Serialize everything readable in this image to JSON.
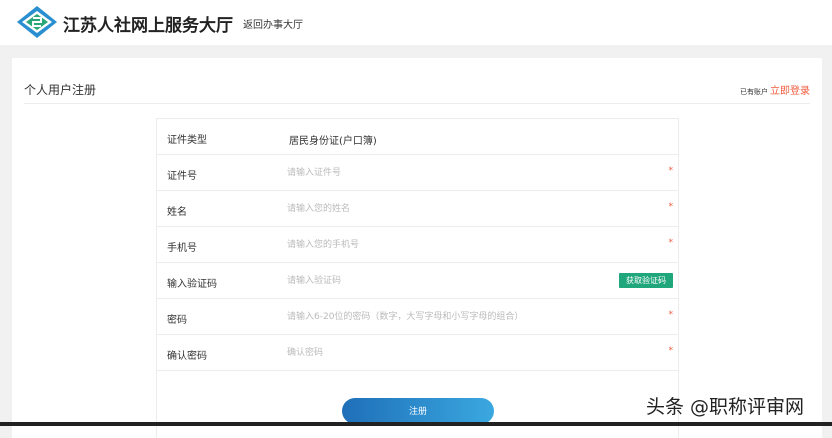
{
  "header": {
    "title": "江苏人社网上服务大厅",
    "back_link": "返回办事大厅"
  },
  "page": {
    "title": "个人用户注册",
    "have_account": "已有账户",
    "login_link": "立即登录"
  },
  "form": {
    "rows": [
      {
        "label": "证件类型",
        "value": "居民身份证(户口簿)"
      },
      {
        "label": "证件号",
        "placeholder": "请输入证件号",
        "required": "*"
      },
      {
        "label": "姓名",
        "placeholder": "请输入您的姓名",
        "required": "*"
      },
      {
        "label": "手机号",
        "placeholder": "请输入您的手机号",
        "required": "*"
      },
      {
        "label": "输入验证码",
        "placeholder": "请输入验证码",
        "button": "获取验证码"
      },
      {
        "label": "密码",
        "placeholder": "请输入6-20位的密码（数字，大写字母和小写字母的组合）",
        "required": "*"
      },
      {
        "label": "确认密码",
        "placeholder": "确认密码",
        "required": "*"
      }
    ],
    "submit": "注册"
  },
  "watermark": "头条 @职称评审网",
  "colors": {
    "accent": "#f05a3c",
    "green": "#1fa67a",
    "blue": "#1f6fb8"
  }
}
